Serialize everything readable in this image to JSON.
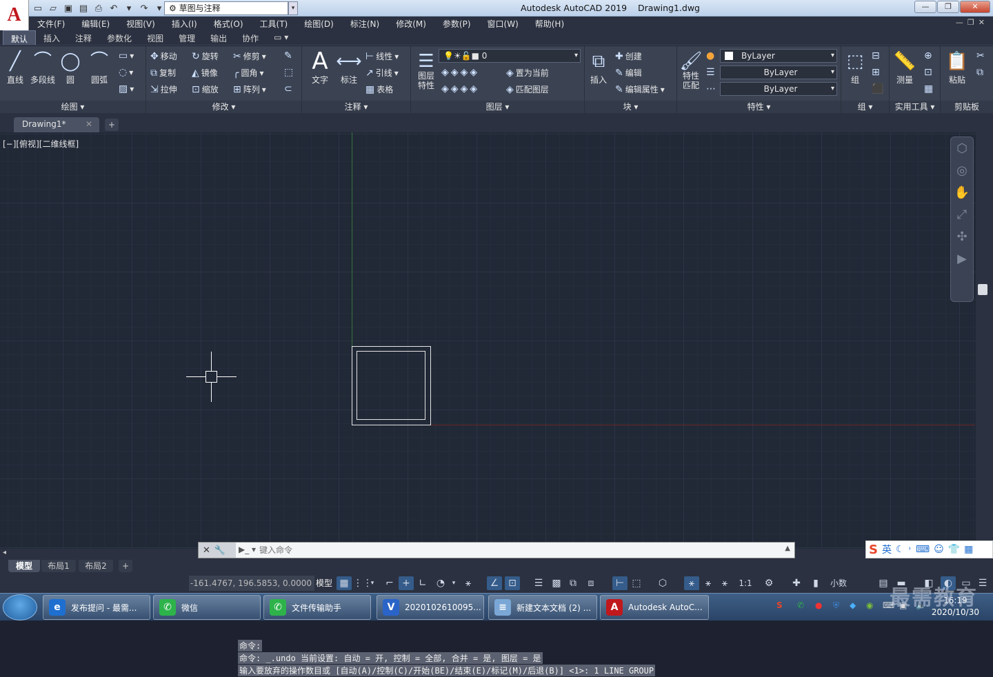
{
  "app": {
    "logo": "A",
    "title": "Autodesk AutoCAD 2019    Drawing1.dwg",
    "workspace": "草图与注释"
  },
  "menus": [
    "文件(F)",
    "编辑(E)",
    "视图(V)",
    "插入(I)",
    "格式(O)",
    "工具(T)",
    "绘图(D)",
    "标注(N)",
    "修改(M)",
    "参数(P)",
    "窗口(W)",
    "帮助(H)"
  ],
  "ribbon_tabs": [
    "默认",
    "插入",
    "注释",
    "参数化",
    "视图",
    "管理",
    "输出",
    "协作"
  ],
  "ribbon": {
    "draw": {
      "label": "绘图 ▾",
      "line": "直线",
      "polyline": "多段线",
      "circle": "圆",
      "arc": "圆弧"
    },
    "modify": {
      "label": "修改 ▾",
      "move": "移动",
      "rotate": "旋转",
      "trim": "修剪",
      "copy": "复制",
      "mirror": "镜像",
      "fillet": "圆角",
      "stretch": "拉伸",
      "scale": "缩放",
      "array": "阵列"
    },
    "annotation": {
      "label": "注释 ▾",
      "text": "文字",
      "dimension": "标注",
      "linetype": "线性",
      "leader": "引线",
      "table": "表格"
    },
    "layers": {
      "label": "图层 ▾",
      "props": "图层\n特性",
      "current_layer": "0",
      "set_current": "置为当前",
      "match_layer": "匹配图层"
    },
    "block": {
      "label": "块 ▾",
      "insert": "插入",
      "create": "创建",
      "edit": "编辑",
      "edit_attr": "编辑属性"
    },
    "properties": {
      "label": "特性 ▾",
      "match": "特性\n匹配",
      "color": "ByLayer",
      "linetype": "ByLayer",
      "lineweight": "ByLayer"
    },
    "groups": {
      "label": "组 ▾",
      "group": "组"
    },
    "utilities": {
      "label": "实用工具 ▾",
      "measure": "测量"
    },
    "clipboard": {
      "label": "剪贴板",
      "paste": "粘贴"
    }
  },
  "document_tab": "Drawing1*",
  "viewport_label": "[−][俯视][二维线框]",
  "command_history": [
    "命令:",
    "命令: _.undo 当前设置: 自动 = 开, 控制 = 全部, 合并 = 是, 图层 = 是",
    "输入要放弃的操作数目或 [自动(A)/控制(C)/开始(BE)/结束(E)/标记(M)/后退(B)] <1>: 1 LINE GROUP"
  ],
  "command_input": {
    "placeholder": "键入命令"
  },
  "layout_tabs": [
    "模型",
    "布局1",
    "布局2"
  ],
  "status": {
    "coords": "-161.4767, 196.5853, 0.0000",
    "model": "模型",
    "scale": "1:1",
    "units": "小数"
  },
  "taskbar": [
    {
      "label": "发布提问 - 最需...",
      "icon": "e",
      "color": "#1e6fd0"
    },
    {
      "label": "微信",
      "icon": "✆",
      "color": "#2db34a"
    },
    {
      "label": "文件传输助手",
      "icon": "✆",
      "color": "#2db34a"
    },
    {
      "label": "2020102610095...",
      "icon": "V",
      "color": "#2a64c8"
    },
    {
      "label": "新建文本文档 (2) ...",
      "icon": "≡",
      "color": "#7aa7d6"
    },
    {
      "label": "Autodesk AutoC...",
      "icon": "A",
      "color": "#c0181c"
    }
  ],
  "clock": {
    "time": "16:19",
    "date": "2020/10/30"
  },
  "ime": {
    "label": "英"
  },
  "watermark": "最需教育"
}
